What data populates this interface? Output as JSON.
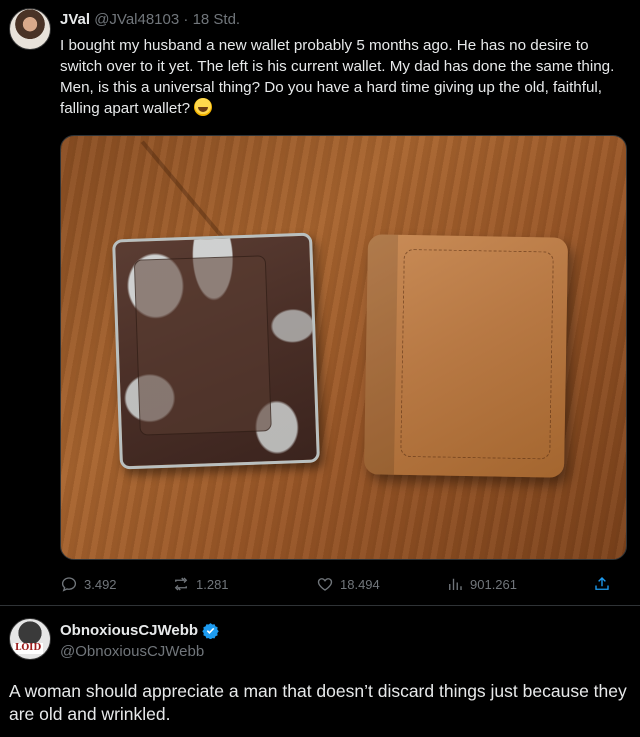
{
  "tweet": {
    "author_name": "JVal",
    "author_handle": "@JVal48103",
    "separator": "·",
    "time": "18 Std.",
    "text": "I bought my husband a new wallet probably 5 months ago. He has no desire to switch over to it yet. The left is his current wallet. My dad has done the same thing. Men, is this a universal thing? Do you have a hard time giving up the old, faithful, falling apart wallet?",
    "emoji": "grinning-sweat-emoji",
    "stats": {
      "replies": "3.492",
      "reposts": "1.281",
      "likes": "18.494",
      "views": "901.261"
    }
  },
  "reply": {
    "author_name": "ObnoxiousCJWebb",
    "author_handle": "@ObnoxiousCJWebb",
    "avatar_text": "LOID",
    "verified": true,
    "text": "A woman should appreciate a man that doesn’t discard things just because they are old and wrinkled."
  },
  "colors": {
    "background": "#000000",
    "text": "#e7e9ea",
    "muted": "#71767b",
    "verified": "#1d9bf0"
  }
}
